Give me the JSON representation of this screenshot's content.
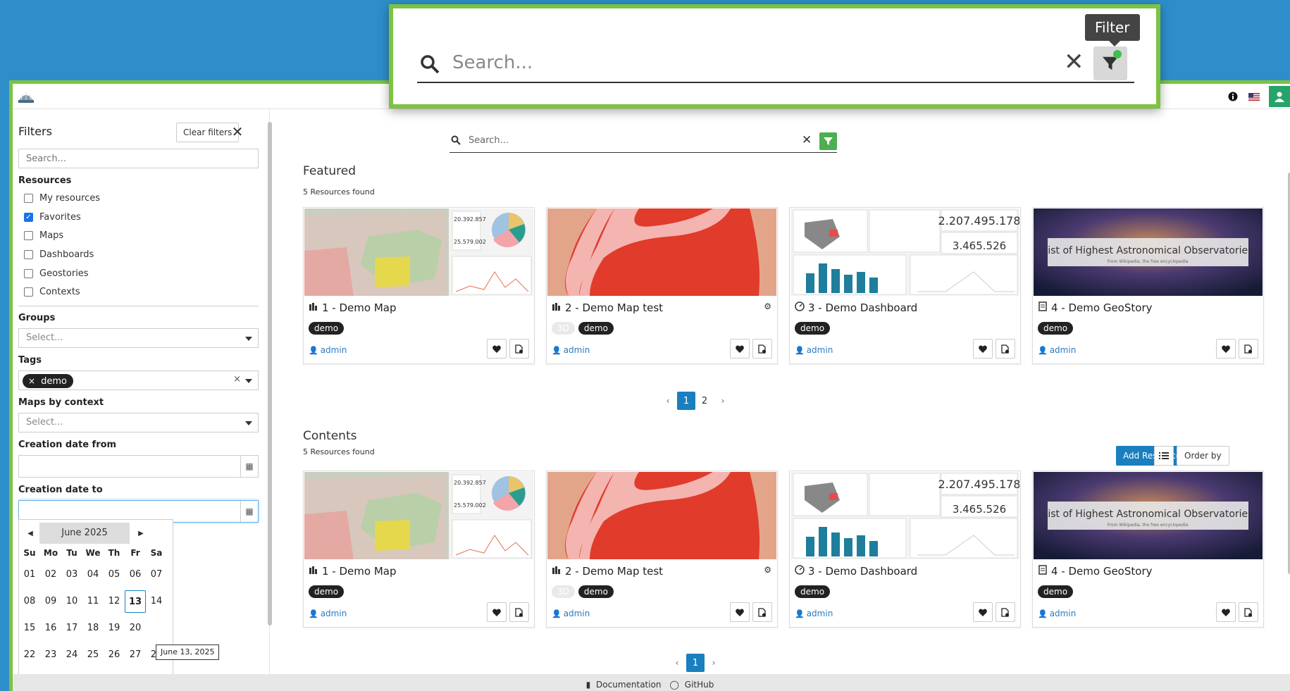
{
  "header": {
    "info_icon": "info-icon",
    "lang_icon": "flag-icon",
    "user_icon": "user-icon"
  },
  "zoom": {
    "placeholder": "Search...",
    "tooltip": "Filter"
  },
  "sidebar": {
    "title": "Filters",
    "clear_label": "Clear filters",
    "search_placeholder": "Search...",
    "resources_title": "Resources",
    "resources": [
      {
        "label": "My resources",
        "checked": false
      },
      {
        "label": "Favorites",
        "checked": true
      },
      {
        "label": "Maps",
        "checked": false
      },
      {
        "label": "Dashboards",
        "checked": false
      },
      {
        "label": "Geostories",
        "checked": false
      },
      {
        "label": "Contexts",
        "checked": false
      }
    ],
    "groups_title": "Groups",
    "groups_placeholder": "Select...",
    "tags_title": "Tags",
    "tag_value": "demo",
    "tag_clear": "×",
    "maps_context_title": "Maps by context",
    "maps_context_placeholder": "Select...",
    "date_from_title": "Creation date from",
    "date_to_title": "Creation date to"
  },
  "picker": {
    "month": "June 2025",
    "dow": [
      "Su",
      "Mo",
      "Tu",
      "We",
      "Th",
      "Fr",
      "Sa"
    ],
    "weeks": [
      [
        "01",
        "02",
        "03",
        "04",
        "05",
        "06",
        "07"
      ],
      [
        "08",
        "09",
        "10",
        "11",
        "12",
        "13",
        "14"
      ],
      [
        "15",
        "16",
        "17",
        "18",
        "19",
        "20",
        ""
      ],
      [
        "22",
        "23",
        "24",
        "25",
        "26",
        "27",
        "28"
      ]
    ],
    "today": "13",
    "tooltip": "June 13, 2025"
  },
  "main": {
    "search_placeholder": "Search...",
    "featured_title": "Featured",
    "featured_count": "5 Resources found",
    "contents_title": "Contents",
    "contents_count": "5 Resources found",
    "add_resource": "Add Resource",
    "order_by": "Order by",
    "featured_pages": [
      "1",
      "2"
    ],
    "contents_pages": [
      "1"
    ]
  },
  "cards": [
    {
      "title": "1 - Demo Map",
      "type": "map",
      "tags": [
        "demo"
      ],
      "owner": "admin",
      "has_3d": false,
      "gear": false
    },
    {
      "title": "2 - Demo Map test",
      "type": "map",
      "tags": [
        "demo"
      ],
      "owner": "admin",
      "has_3d": true,
      "label_3d": "3D",
      "gear": true
    },
    {
      "title": "3 - Demo Dashboard",
      "type": "dashboard",
      "tags": [
        "demo"
      ],
      "owner": "admin",
      "has_3d": false,
      "gear": false,
      "num1": "2.207.495.178",
      "num2": "3.465.526"
    },
    {
      "title": "4 - Demo GeoStory",
      "type": "geostory",
      "tags": [
        "demo"
      ],
      "owner": "admin",
      "has_3d": false,
      "gear": false,
      "banner": "List of Highest Astronomical Observatories",
      "banner_sub": "From Wikipedia, the free encyclopedia"
    }
  ],
  "thumb1": {
    "n1": "20.392.857",
    "n2": "25.579.002"
  },
  "footer": {
    "doc": "Documentation",
    "github": "GitHub"
  }
}
